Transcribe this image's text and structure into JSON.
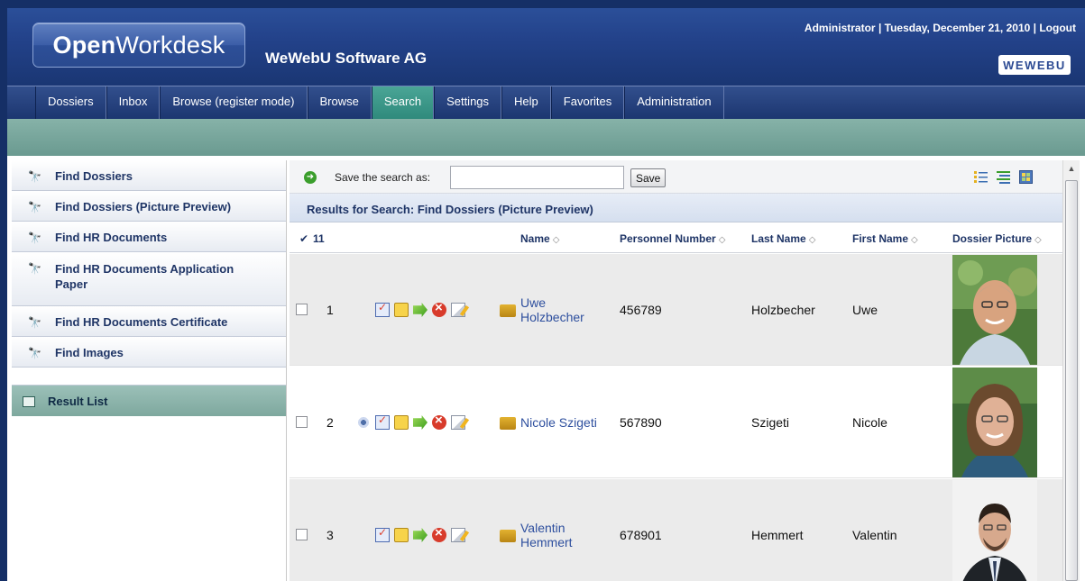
{
  "header": {
    "logo_bold": "Open",
    "logo_rest": "Workdesk",
    "company": "WeWebU Software AG",
    "user": "Administrator",
    "date": "Tuesday, December 21, 2010",
    "logout": "Logout",
    "brand": "WEWEBU",
    "separator": "|"
  },
  "nav": {
    "items": [
      "Dossiers",
      "Inbox",
      "Browse (register mode)",
      "Browse",
      "Search",
      "Settings",
      "Help",
      "Favorites",
      "Administration"
    ],
    "active": "Search"
  },
  "sidebar": {
    "items": [
      "Find Dossiers",
      "Find Dossiers (Picture Preview)",
      "Find HR Documents",
      "Find HR Documents Application Paper",
      "Find HR Documents Certificate",
      "Find Images"
    ],
    "result_list": "Result List"
  },
  "savebar": {
    "label": "Save the search as:",
    "value": "",
    "button": "Save"
  },
  "results": {
    "title": "Results for Search: Find Dossiers (Picture Preview)",
    "count": "11",
    "check_mark": "✔",
    "columns": {
      "name": "Name",
      "personnel_number": "Personnel Number",
      "last_name": "Last Name",
      "first_name": "First Name",
      "dossier_picture": "Dossier Picture"
    },
    "rows": [
      {
        "num": "1",
        "name_line1": "Uwe",
        "name_line2": "Holzbecher",
        "pn": "456789",
        "last": "Holzbecher",
        "first": "Uwe"
      },
      {
        "num": "2",
        "name_line1": "Nicole Szigeti",
        "name_line2": "",
        "pn": "567890",
        "last": "Szigeti",
        "first": "Nicole"
      },
      {
        "num": "3",
        "name_line1": "Valentin",
        "name_line2": "Hemmert",
        "pn": "678901",
        "last": "Hemmert",
        "first": "Valentin"
      }
    ]
  },
  "colors": {
    "header_blue": "#23428a",
    "nav_active": "#2f8a7c",
    "subbar": "#6a9a90",
    "link": "#2e4f9e"
  }
}
